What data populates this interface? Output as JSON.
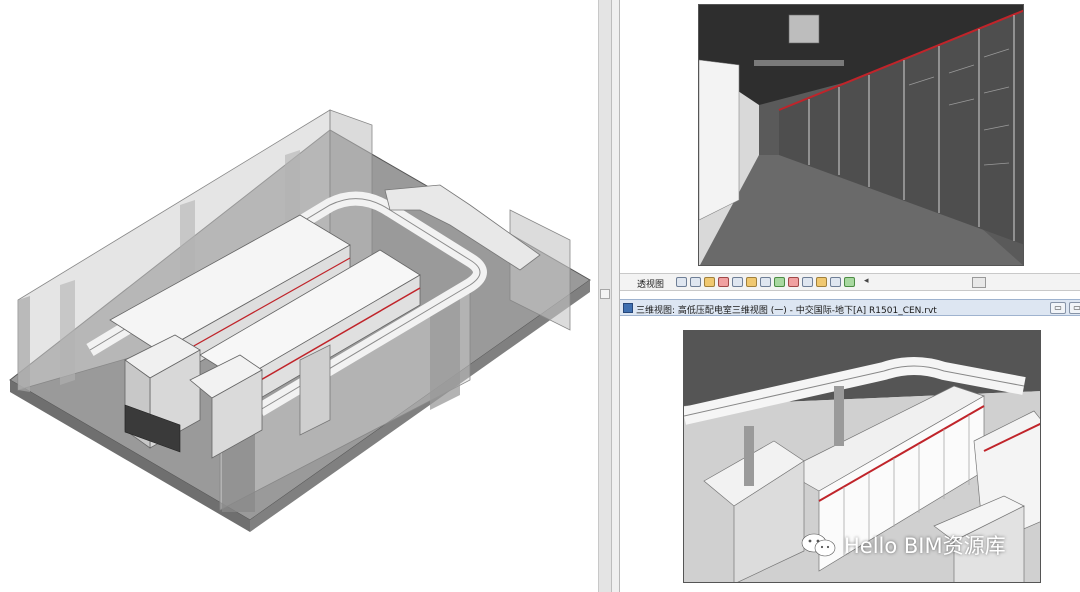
{
  "view_control_bar": {
    "label": "透视图",
    "icons": [
      "visual-style-icon",
      "sun-path-icon",
      "shadows-icon",
      "crop-region-icon",
      "show-crop-icon",
      "render-icon",
      "lock-view-icon",
      "temp-hide-icon",
      "reveal-hidden-icon",
      "analysis-icon",
      "highlight-icon",
      "constraints-icon",
      "worksharing-icon"
    ]
  },
  "bottom_window": {
    "title": "三维视图: 高低压配电室三维视图 (一) - 中交国际-地下[A] R1501_CEN.rvt",
    "minimize_label": "▭",
    "restore_label": "▭"
  },
  "watermark": {
    "text": "Hello BIM资源库"
  },
  "colors": {
    "accent_red": "#c0242a",
    "panel_gray": "#e4e4e4",
    "title_bar": "#dde6f2"
  }
}
